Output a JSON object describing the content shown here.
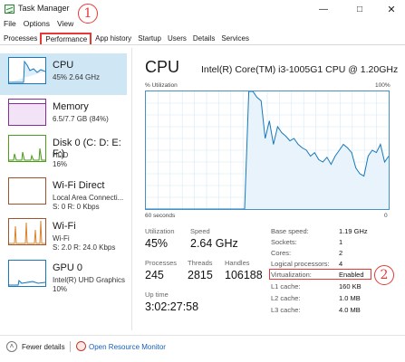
{
  "window": {
    "title": "Task Manager"
  },
  "annotations": {
    "one": "1",
    "two": "2"
  },
  "menu": [
    "File",
    "Options",
    "View"
  ],
  "tabs": [
    "Processes",
    "Performance",
    "App history",
    "Startup",
    "Users",
    "Details",
    "Services"
  ],
  "active_tab": "Performance",
  "resources": [
    {
      "title": "CPU",
      "sub": [
        "45%  2.64 GHz"
      ],
      "color": "#1779ba"
    },
    {
      "title": "Memory",
      "sub": [
        "6.5/7.7 GB (84%)"
      ],
      "color": "#8b2a9e"
    },
    {
      "title": "Disk 0 (C: D: E: F:)",
      "sub": [
        "HDD",
        "16%"
      ],
      "color": "#4d9a1e"
    },
    {
      "title": "Wi-Fi Direct",
      "sub": [
        "Local Area Connecti...",
        "S: 0 R: 0 Kbps"
      ],
      "color": "#a0522d"
    },
    {
      "title": "Wi-Fi",
      "sub": [
        "Wi-Fi",
        "S: 2.0  R: 24.0 Kbps"
      ],
      "color": "#a0522d"
    },
    {
      "title": "GPU 0",
      "sub": [
        "Intel(R) UHD Graphics",
        "10%"
      ],
      "color": "#1779ba"
    }
  ],
  "cpu": {
    "heading": "CPU",
    "name": "Intel(R) Core(TM) i3-1005G1 CPU @ 1.20GHz",
    "graph_label_left": "% Utilization",
    "graph_label_right": "100%",
    "graph_label_bottom": "60 seconds",
    "graph_label_bottom_right": "0",
    "stats": {
      "utilization_label": "Utilization",
      "utilization": "45%",
      "speed_label": "Speed",
      "speed": "2.64 GHz",
      "processes_label": "Processes",
      "processes": "245",
      "threads_label": "Threads",
      "threads": "2815",
      "handles_label": "Handles",
      "handles": "106188",
      "uptime_label": "Up time",
      "uptime": "3:02:27:58"
    },
    "specs": [
      {
        "label": "Base speed:",
        "value": "1.19 GHz"
      },
      {
        "label": "Sockets:",
        "value": "1"
      },
      {
        "label": "Cores:",
        "value": "2"
      },
      {
        "label": "Logical processors:",
        "value": "4"
      },
      {
        "label": "Virtualization:",
        "value": "Enabled"
      },
      {
        "label": "L1 cache:",
        "value": "160 KB"
      },
      {
        "label": "L2 cache:",
        "value": "1.0 MB"
      },
      {
        "label": "L3 cache:",
        "value": "4.0 MB"
      }
    ],
    "utilization_series": [
      0,
      0,
      0,
      0,
      0,
      0,
      0,
      0,
      0,
      0,
      0,
      0,
      0,
      0,
      0,
      0,
      0,
      0,
      0,
      0,
      0,
      0,
      0,
      0,
      0,
      100,
      100,
      95,
      92,
      60,
      75,
      55,
      70,
      65,
      62,
      58,
      60,
      55,
      52,
      50,
      45,
      48,
      42,
      40,
      44,
      38,
      45,
      50,
      55,
      52,
      48,
      35,
      30,
      28,
      45,
      50,
      48,
      55,
      40,
      45
    ]
  },
  "footer": {
    "fewer_details": "Fewer details",
    "open_resource_monitor": "Open Resource Monitor"
  },
  "colors": {
    "accent": "#1779ba",
    "annotation": "#e53935",
    "selected": "#cfe6f5",
    "link": "#1a5fb4"
  }
}
